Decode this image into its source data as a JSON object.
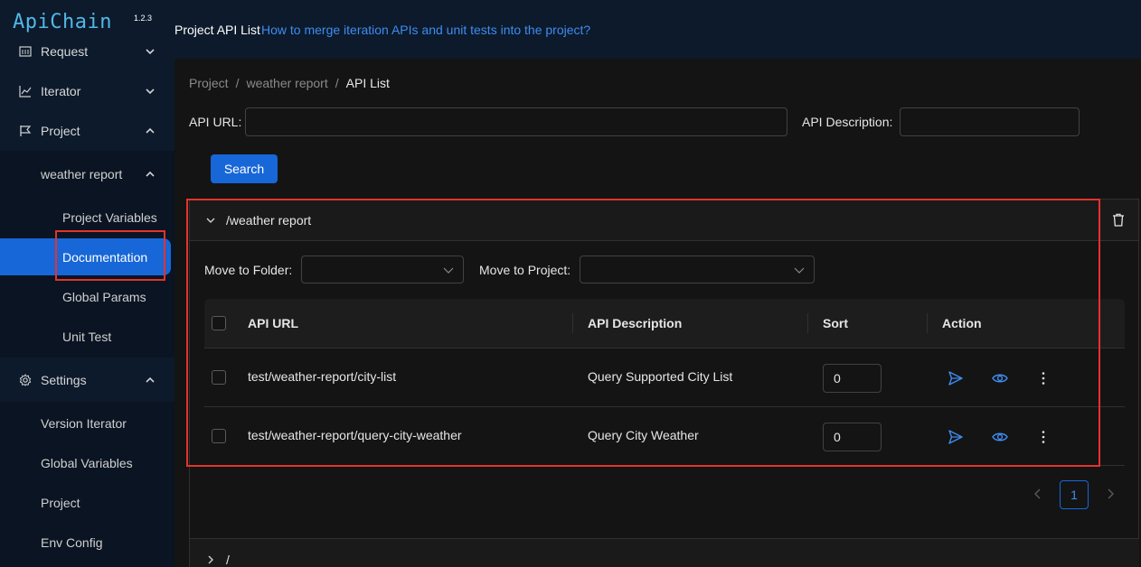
{
  "app": {
    "name": "ApiChain",
    "version": "1.2.3"
  },
  "sidebar": {
    "items": [
      {
        "label": "Request",
        "icon": "request-icon"
      },
      {
        "label": "Iterator",
        "icon": "chart-line-icon"
      },
      {
        "label": "Project",
        "icon": "flag-icon"
      },
      {
        "label": "weather report"
      },
      {
        "label": "Project Variables"
      },
      {
        "label": "Documentation",
        "active": true
      },
      {
        "label": "Global Params"
      },
      {
        "label": "Unit Test"
      },
      {
        "label": "Settings",
        "icon": "gear-icon"
      },
      {
        "label": "Version Iterator"
      },
      {
        "label": "Global Variables"
      },
      {
        "label": "Project"
      },
      {
        "label": "Env Config"
      }
    ]
  },
  "topbar": {
    "title": "Project API List",
    "help_link": "How to merge iteration APIs and unit tests into the project?"
  },
  "breadcrumb": {
    "items": [
      "Project",
      "weather report",
      "API List"
    ],
    "separator": "/"
  },
  "search": {
    "url_label": "API URL:",
    "url_value": "",
    "desc_label": "API Description:",
    "desc_value": "",
    "button": "Search"
  },
  "folder_panel": {
    "title": "/weather report",
    "move_folder_label": "Move to Folder:",
    "move_project_label": "Move to Project:",
    "columns": [
      "API URL",
      "API Description",
      "Sort",
      "Action"
    ],
    "rows": [
      {
        "url": "test/weather-report/city-list",
        "description": "Query Supported City List",
        "sort": "0"
      },
      {
        "url": "test/weather-report/query-city-weather",
        "description": "Query City Weather",
        "sort": "0"
      }
    ],
    "pagination": {
      "current": "1"
    }
  },
  "root_panel": {
    "title": "/"
  },
  "colors": {
    "accent": "#1767d8",
    "link": "#3f8cf0",
    "annotation": "#e5322d",
    "sidebar_bg": "#0c1a2b"
  }
}
